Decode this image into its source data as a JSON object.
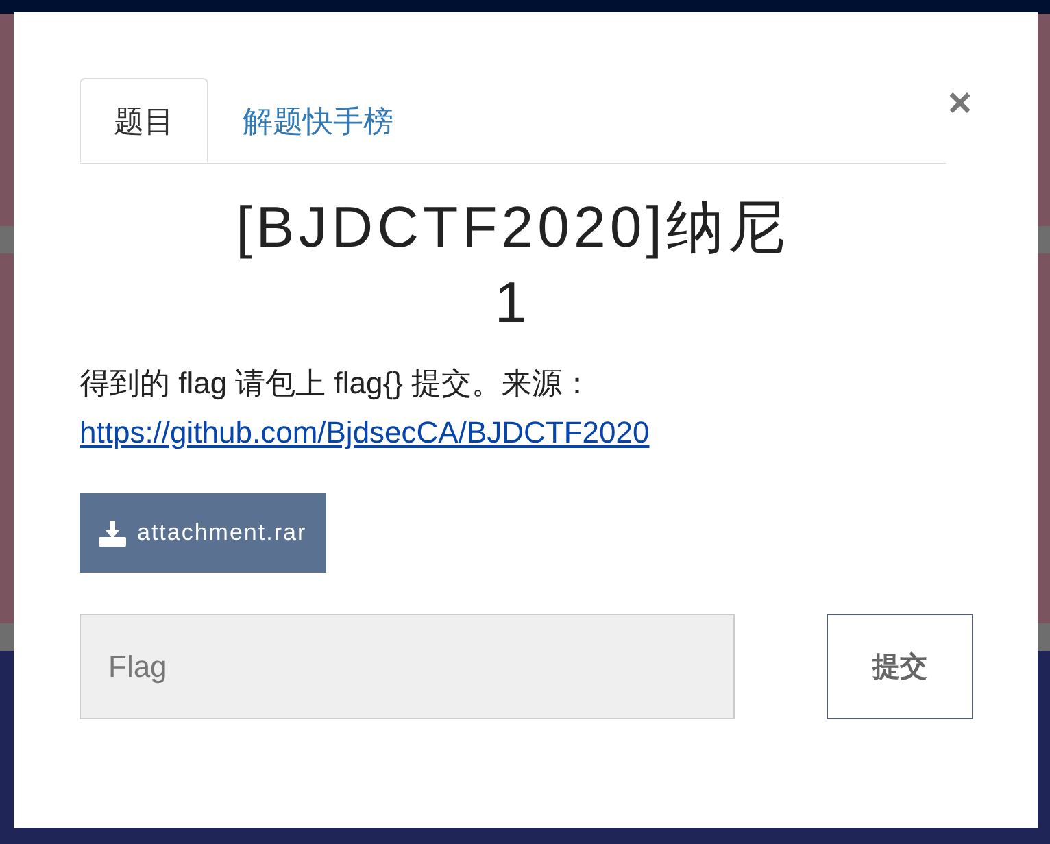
{
  "tabs": [
    {
      "label": "题目",
      "selected": true
    },
    {
      "label": "解题快手榜",
      "selected": false
    }
  ],
  "close": "×",
  "title": "[BJDCTF2020]纳尼 1",
  "description": {
    "text": "得到的 flag 请包上 flag{} 提交。来源：",
    "link": "https://github.com/BjdsecCA/BJDCTF2020"
  },
  "attachment": "attachment.rar",
  "flag_input": {
    "placeholder": "Flag"
  },
  "submit": "提交"
}
